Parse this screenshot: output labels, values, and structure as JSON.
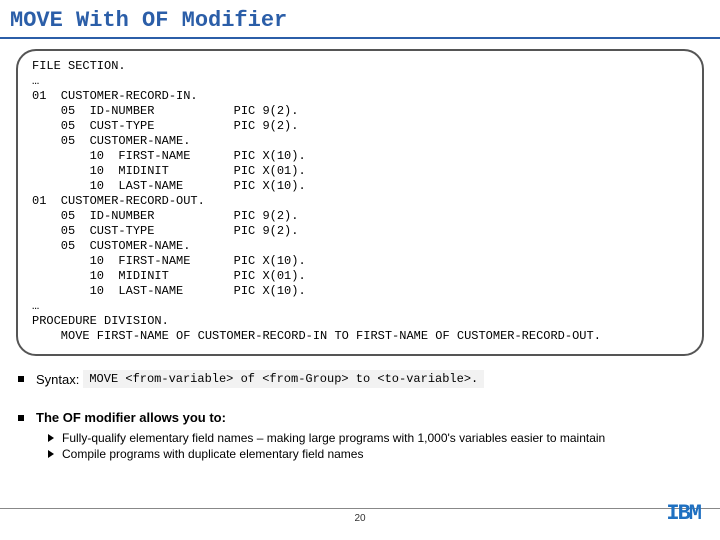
{
  "title": "MOVE With OF Modifier",
  "code": "FILE SECTION.\n…\n01  CUSTOMER-RECORD-IN.\n    05  ID-NUMBER           PIC 9(2).\n    05  CUST-TYPE           PIC 9(2).\n    05  CUSTOMER-NAME.\n        10  FIRST-NAME      PIC X(10).\n        10  MIDINIT         PIC X(01).\n        10  LAST-NAME       PIC X(10).\n01  CUSTOMER-RECORD-OUT.\n    05  ID-NUMBER           PIC 9(2).\n    05  CUST-TYPE           PIC 9(2).\n    05  CUSTOMER-NAME.\n        10  FIRST-NAME      PIC X(10).\n        10  MIDINIT         PIC X(01).\n        10  LAST-NAME       PIC X(10).\n…\nPROCEDURE DIVISION.\n    MOVE FIRST-NAME OF CUSTOMER-RECORD-IN TO FIRST-NAME OF CUSTOMER-RECORD-OUT.",
  "syntax_label": "Syntax:",
  "syntax_box": "MOVE <from-variable> of <from-Group> to  <to-variable>.",
  "of_heading": "The OF modifier allows you to:",
  "sub1": "Fully-qualify elementary field names – making large programs with 1,000's variables easier to maintain",
  "sub2": "Compile programs with duplicate elementary field names",
  "page": "20",
  "logo": "IBM"
}
